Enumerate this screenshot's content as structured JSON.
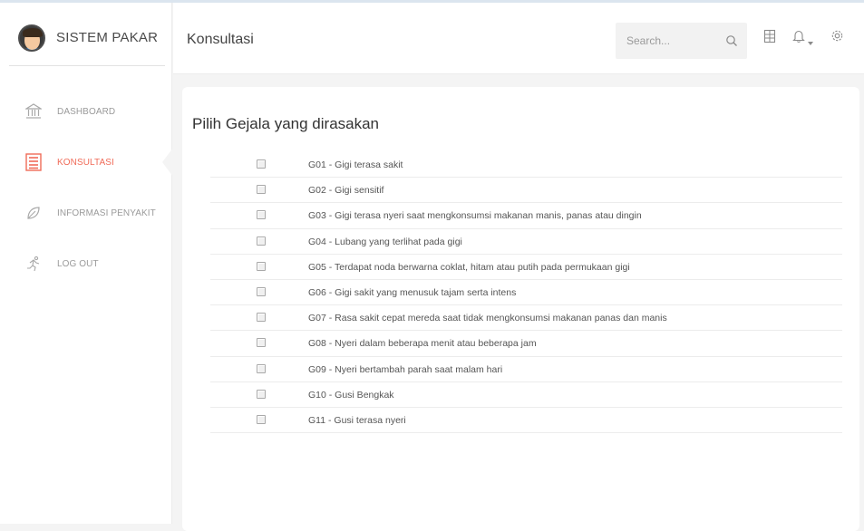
{
  "app": {
    "brand": "SISTEM PAKAR"
  },
  "sidebar": {
    "items": [
      {
        "label": "DASHBOARD",
        "icon": "bank-icon",
        "active": false
      },
      {
        "label": "KONSULTASI",
        "icon": "list-icon",
        "active": true
      },
      {
        "label": "INFORMASI PENYAKIT",
        "icon": "leaf-icon",
        "active": false
      },
      {
        "label": "LOG OUT",
        "icon": "run-icon",
        "active": false
      }
    ]
  },
  "header": {
    "title": "Konsultasi",
    "search_placeholder": "Search...",
    "icons": [
      "search-icon",
      "grid-icon",
      "bell-icon",
      "caret-down-icon",
      "gear-icon"
    ]
  },
  "main": {
    "heading": "Pilih Gejala yang dirasakan",
    "symptoms": [
      "G01 - Gigi terasa sakit",
      "G02 - Gigi sensitif",
      "G03 - Gigi terasa nyeri saat mengkonsumsi makanan manis, panas atau dingin",
      "G04 - Lubang yang terlihat pada gigi",
      "G05 - Terdapat noda berwarna coklat, hitam atau putih pada permukaan gigi",
      "G06 - Gigi sakit yang menusuk tajam serta intens",
      "G07 - Rasa sakit cepat mereda saat tidak mengkonsumsi makanan panas dan manis",
      "G08 - Nyeri dalam beberapa menit atau beberapa jam",
      "G09 - Nyeri bertambah parah saat malam hari",
      "G10 - Gusi Bengkak",
      "G11 - Gusi terasa nyeri"
    ]
  },
  "colors": {
    "accent": "#f06b58",
    "muted": "#9a9a9a",
    "background": "#f4f4f4"
  }
}
